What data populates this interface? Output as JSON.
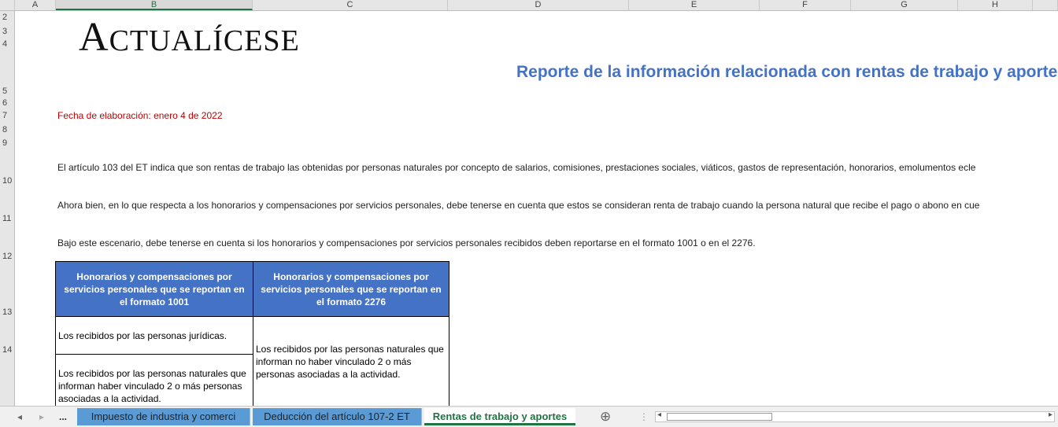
{
  "columns": [
    "A",
    "B",
    "C",
    "D",
    "E",
    "F",
    "G",
    "H"
  ],
  "selected_column": "B",
  "rows": [
    "2",
    "3",
    "4",
    "5",
    "6",
    "7",
    "8",
    "9",
    "10",
    "11",
    "12",
    "13",
    "14"
  ],
  "logo_text": "Actualícese",
  "title": "Reporte de la información relacionada con rentas de trabajo y aporte",
  "fecha": "Fecha de elaboración: enero 4 de 2022",
  "paragraphs": [
    "El artículo 103 del ET indica que son rentas de trabajo las obtenidas por personas naturales por concepto de salarios, comisiones, prestaciones sociales, viáticos, gastos de representación, honorarios, emolumentos ecle",
    "Ahora bien, en lo que respecta a los honorarios y compensaciones por servicios personales, debe tenerse en cuenta que estos se consideran renta de trabajo cuando la persona natural que recibe el pago o abono en cue",
    "Bajo este escenario, debe tenerse en cuenta si los honorarios y compensaciones por servicios personales recibidos deben reportarse en el formato 1001 o en el 2276."
  ],
  "table": {
    "headers": [
      "Honorarios y compensaciones por servicios personales que se reportan en el formato 1001",
      "Honorarios y compensaciones por servicios personales que se reportan en el formato 2276"
    ],
    "col1": [
      "Los recibidos por las personas jurídicas.",
      "Los recibidos por las personas naturales que informan haber vinculado 2 o más personas asociadas a la actividad."
    ],
    "col2": "Los recibidos por las personas naturales que informan no haber vinculado 2 o más personas asociadas a la actividad."
  },
  "tabs": {
    "ellipsis": "...",
    "items": [
      "Impuesto de industria y comerci",
      "Deducción del artículo 107-2 ET",
      "Rentas de trabajo y aportes"
    ],
    "active_index": 2,
    "add_icon": "⊕"
  }
}
